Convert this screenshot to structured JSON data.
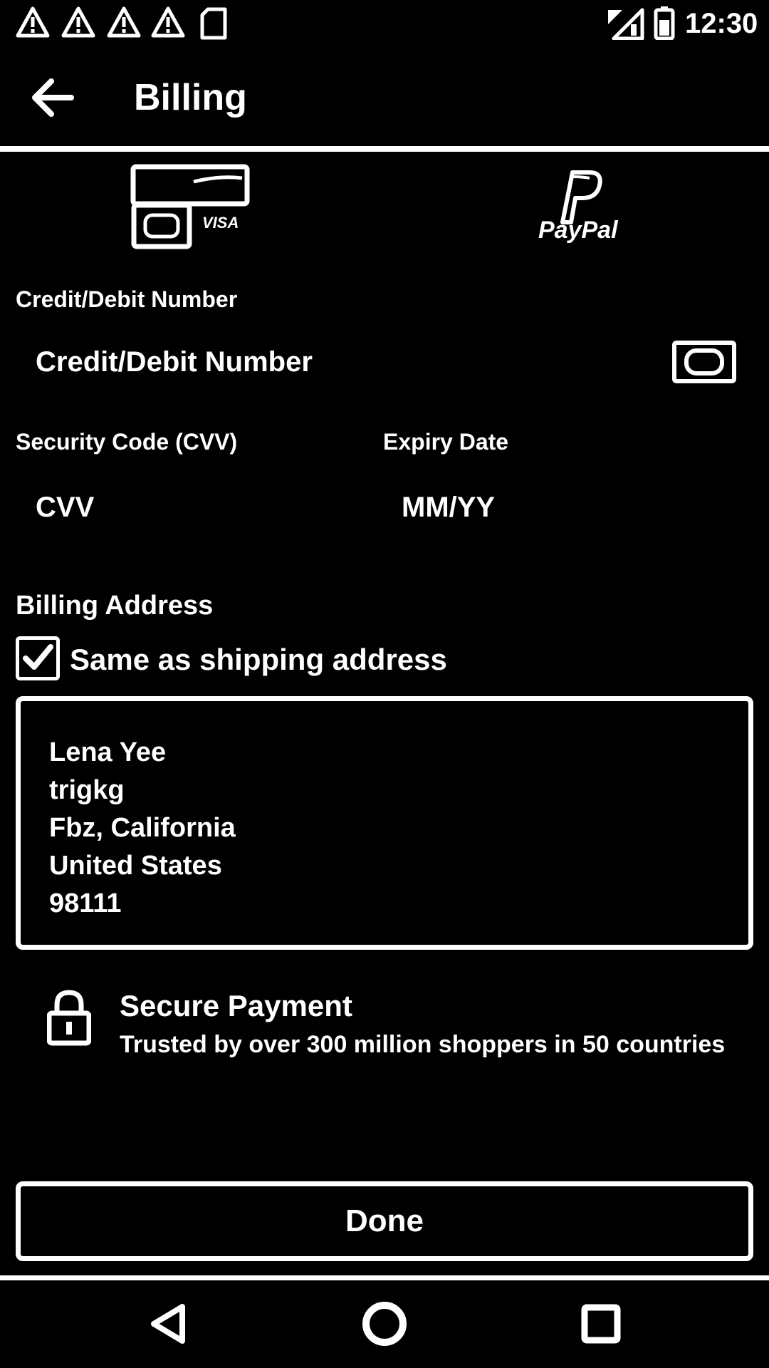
{
  "status_bar": {
    "time": "12:30",
    "icons": [
      "warning-icon",
      "warning-icon",
      "warning-icon",
      "warning-icon",
      "sd-card-icon",
      "signal-icon",
      "battery-icon"
    ]
  },
  "app_bar": {
    "title": "Billing",
    "back_icon": "arrow-left-icon"
  },
  "payment_tabs": [
    {
      "label": "VISA",
      "icon": "credit-card-icon"
    },
    {
      "label": "PayPal",
      "icon": "paypal-icon"
    }
  ],
  "card_number": {
    "label": "Credit/Debit Number",
    "placeholder": "Credit/Debit Number",
    "icon": "card-scan-icon"
  },
  "cvv": {
    "label": "Security Code (CVV)",
    "placeholder": "CVV"
  },
  "expiry": {
    "label": "Expiry Date",
    "placeholder": "MM/YY"
  },
  "billing_address": {
    "heading": "Billing Address",
    "same_as_shipping_label": "Same as shipping address",
    "same_as_shipping_checked": true,
    "lines": [
      "Lena Yee",
      "trigkg",
      "Fbz, California",
      "United States",
      "98111"
    ]
  },
  "secure_payment": {
    "title": "Secure Payment",
    "subtitle": "Trusted by over 300 million shoppers in 50 countries",
    "icon": "lock-icon"
  },
  "done_button": {
    "label": "Done"
  },
  "nav_bar": {
    "icons": [
      "nav-back-icon",
      "nav-home-icon",
      "nav-recents-icon"
    ]
  },
  "colors": {
    "background": "#000000",
    "foreground": "#ffffff"
  }
}
